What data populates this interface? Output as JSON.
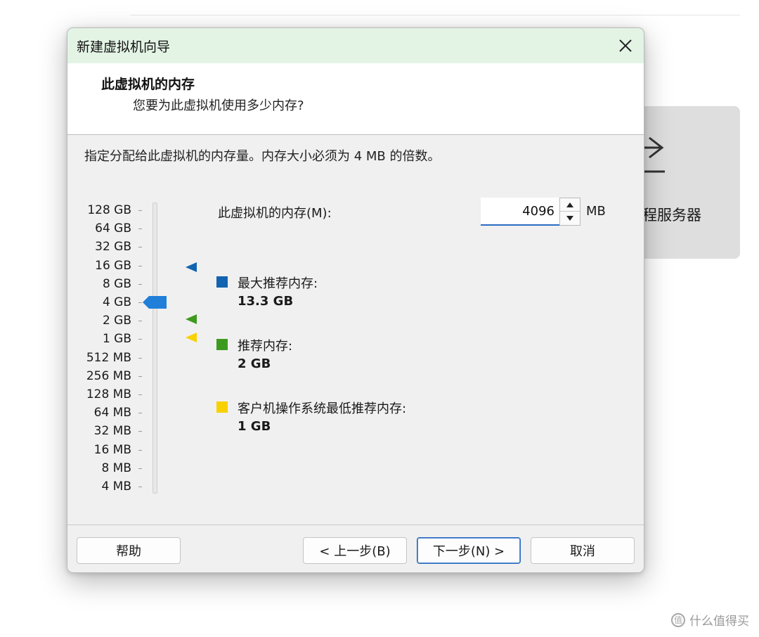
{
  "background": {
    "card_label": "程服务器",
    "watermark": "什么值得买",
    "watermark_glyph": "值"
  },
  "dialog": {
    "title": "新建虚拟机向导",
    "header_title": "此虚拟机的内存",
    "header_subtitle": "您要为此虚拟机使用多少内存?",
    "instruction": "指定分配给此虚拟机的内存量。内存大小必须为 4 MB 的倍数。",
    "scale_labels": [
      "128 GB",
      "64 GB",
      "32 GB",
      "16 GB",
      "8 GB",
      "4 GB",
      "2 GB",
      "1 GB",
      "512 MB",
      "256 MB",
      "128 MB",
      "64 MB",
      "32 MB",
      "16 MB",
      "8 MB",
      "4 MB"
    ],
    "selected_level": "4 GB",
    "memory_label": "此虚拟机的内存(M):",
    "memory_value": "4096",
    "memory_unit": "MB",
    "legend": [
      {
        "label": "最大推荐内存:",
        "value": "13.3 GB",
        "color": "#1264b0"
      },
      {
        "label": "推荐内存:",
        "value": "2 GB",
        "color": "#3e9a1e"
      },
      {
        "label": "客户机操作系统最低推荐内存:",
        "value": "1 GB",
        "color": "#f7d100"
      }
    ],
    "thumb_color": "#1f7fd9",
    "buttons": {
      "help": "帮助",
      "back": "< 上一步(B)",
      "next": "下一步(N) >",
      "cancel": "取消"
    }
  }
}
